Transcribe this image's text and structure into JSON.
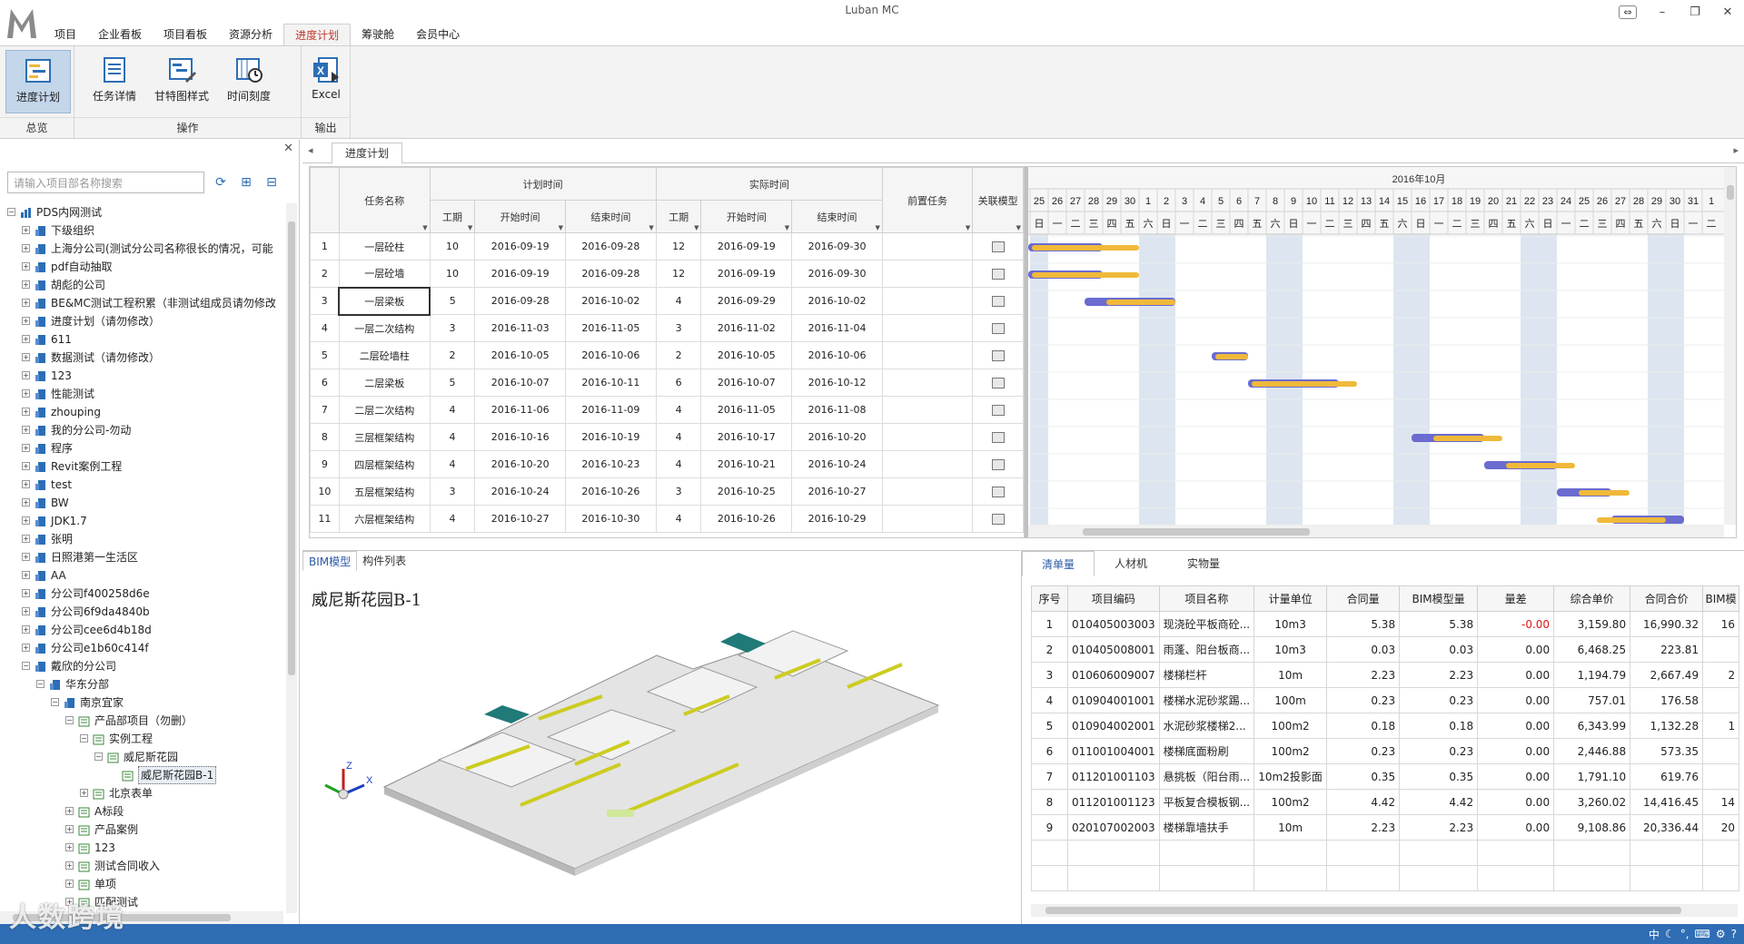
{
  "window": {
    "title": "Luban MC"
  },
  "menu": [
    "项目",
    "企业看板",
    "项目看板",
    "资源分析",
    "进度计划",
    "筹驶舱",
    "会员中心"
  ],
  "menu_active": 4,
  "ribbon": {
    "buttons": [
      {
        "label": "进度计划",
        "icon": "schedule-icon",
        "selected": true
      },
      {
        "label": "任务详情",
        "icon": "task-details-icon"
      },
      {
        "label": "甘特图样式",
        "icon": "gantt-style-icon"
      },
      {
        "label": "时间刻度",
        "icon": "time-scale-icon"
      },
      {
        "label": "Excel",
        "icon": "excel-icon"
      }
    ],
    "groups": [
      "总览",
      "操作",
      "输出"
    ]
  },
  "left_panel": {
    "search_placeholder": "请输入项目部名称搜索",
    "tree": [
      {
        "label": "PDS内网测试",
        "level": 0,
        "expanded": true
      },
      {
        "label": "下级组织",
        "level": 1
      },
      {
        "label": "上海分公司(测试分公司名称很长的情况，可能",
        "level": 1
      },
      {
        "label": "pdf自动抽取",
        "level": 1
      },
      {
        "label": "胡彪的公司",
        "level": 1
      },
      {
        "label": "BE&MC测试工程积累（非测试组成员请勿修改",
        "level": 1
      },
      {
        "label": "进度计划（请勿修改）",
        "level": 1
      },
      {
        "label": "611",
        "level": 1
      },
      {
        "label": "数据测试（请勿修改）",
        "level": 1
      },
      {
        "label": "123",
        "level": 1
      },
      {
        "label": "性能测试",
        "level": 1
      },
      {
        "label": "zhouping",
        "level": 1
      },
      {
        "label": "我的分公司-勿动",
        "level": 1
      },
      {
        "label": "程序",
        "level": 1
      },
      {
        "label": "Revit案例工程",
        "level": 1
      },
      {
        "label": "test",
        "level": 1
      },
      {
        "label": "BW",
        "level": 1
      },
      {
        "label": "JDK1.7",
        "level": 1
      },
      {
        "label": "张明",
        "level": 1
      },
      {
        "label": "日照港第一生活区",
        "level": 1
      },
      {
        "label": "AA",
        "level": 1
      },
      {
        "label": "分公司f400258d6e",
        "level": 1
      },
      {
        "label": "分公司6f9da4840b",
        "level": 1
      },
      {
        "label": "分公司cee6d4b18d",
        "level": 1
      },
      {
        "label": "分公司e1b60c414f",
        "level": 1
      },
      {
        "label": "戴欣的分公司",
        "level": 1,
        "expanded": true
      },
      {
        "label": "华东分部",
        "level": 2,
        "expanded": true
      },
      {
        "label": "南京宜家",
        "level": 3,
        "expanded": true
      },
      {
        "label": "产品部项目（勿删）",
        "level": 4,
        "expanded": true
      },
      {
        "label": "实例工程",
        "level": 5,
        "expanded": true
      },
      {
        "label": "威尼斯花园",
        "level": 6,
        "expanded": true
      },
      {
        "label": "威尼斯花园B-1",
        "level": 7,
        "selected": true
      },
      {
        "label": "北京表单",
        "level": 5
      },
      {
        "label": "A标段",
        "level": 4
      },
      {
        "label": "产品案例",
        "level": 4
      },
      {
        "label": "123",
        "level": 4
      },
      {
        "label": "测试合同收入",
        "level": 4
      },
      {
        "label": "单项",
        "level": 4
      },
      {
        "label": "匹配测试",
        "level": 4
      }
    ]
  },
  "main_tab": "进度计划",
  "task_grid": {
    "headers": {
      "task_name": "任务名称",
      "plan_time": "计划时间",
      "actual_time": "实际时间",
      "duration": "工期",
      "start": "开始时间",
      "end": "结束时间",
      "predecessor": "前置任务",
      "linked_model": "关联模型"
    },
    "rows": [
      {
        "no": "1",
        "name": "一层砼柱",
        "pd": "10",
        "ps": "2016-09-19",
        "pe": "2016-09-28",
        "ad": "12",
        "as": "2016-09-19",
        "ae": "2016-09-30"
      },
      {
        "no": "2",
        "name": "一层砼墙",
        "pd": "10",
        "ps": "2016-09-19",
        "pe": "2016-09-28",
        "ad": "12",
        "as": "2016-09-19",
        "ae": "2016-09-30"
      },
      {
        "no": "3",
        "name": "一层梁板",
        "pd": "5",
        "ps": "2016-09-28",
        "pe": "2016-10-02",
        "ad": "4",
        "as": "2016-09-29",
        "ae": "2016-10-02"
      },
      {
        "no": "4",
        "name": "一层二次结构",
        "pd": "3",
        "ps": "2016-11-03",
        "pe": "2016-11-05",
        "ad": "3",
        "as": "2016-11-02",
        "ae": "2016-11-04"
      },
      {
        "no": "5",
        "name": "二层砼墙柱",
        "pd": "2",
        "ps": "2016-10-05",
        "pe": "2016-10-06",
        "ad": "2",
        "as": "2016-10-05",
        "ae": "2016-10-06"
      },
      {
        "no": "6",
        "name": "二层梁板",
        "pd": "5",
        "ps": "2016-10-07",
        "pe": "2016-10-11",
        "ad": "6",
        "as": "2016-10-07",
        "ae": "2016-10-12"
      },
      {
        "no": "7",
        "name": "二层二次结构",
        "pd": "4",
        "ps": "2016-11-06",
        "pe": "2016-11-09",
        "ad": "4",
        "as": "2016-11-05",
        "ae": "2016-11-08"
      },
      {
        "no": "8",
        "name": "三层框架结构",
        "pd": "4",
        "ps": "2016-10-16",
        "pe": "2016-10-19",
        "ad": "4",
        "as": "2016-10-17",
        "ae": "2016-10-20"
      },
      {
        "no": "9",
        "name": "四层框架结构",
        "pd": "4",
        "ps": "2016-10-20",
        "pe": "2016-10-23",
        "ad": "4",
        "as": "2016-10-21",
        "ae": "2016-10-24"
      },
      {
        "no": "10",
        "name": "五层框架结构",
        "pd": "3",
        "ps": "2016-10-24",
        "pe": "2016-10-26",
        "ad": "3",
        "as": "2016-10-25",
        "ae": "2016-10-27"
      },
      {
        "no": "11",
        "name": "六层框架结构",
        "pd": "4",
        "ps": "2016-10-27",
        "pe": "2016-10-30",
        "ad": "4",
        "as": "2016-10-26",
        "ae": "2016-10-29"
      }
    ]
  },
  "gantt": {
    "month_label": "2016年10月",
    "days": [
      "25",
      "26",
      "27",
      "28",
      "29",
      "30",
      "1",
      "2",
      "3",
      "4",
      "5",
      "6",
      "7",
      "8",
      "9",
      "10",
      "11",
      "12",
      "13",
      "14",
      "15",
      "16",
      "17",
      "18",
      "19",
      "20",
      "21",
      "22",
      "23",
      "24",
      "25",
      "26",
      "27",
      "28",
      "29",
      "30",
      "31",
      "1"
    ],
    "weekdays": [
      "日",
      "一",
      "二",
      "三",
      "四",
      "五",
      "六",
      "日",
      "一",
      "二",
      "三",
      "四",
      "五",
      "六",
      "日",
      "一",
      "二",
      "三",
      "四",
      "五",
      "六",
      "日",
      "一",
      "二",
      "三",
      "四",
      "五",
      "六",
      "日",
      "一",
      "二",
      "三",
      "四",
      "五",
      "六",
      "日",
      "一",
      "二"
    ],
    "colors": {
      "plan": "#6b6bd0",
      "actual": "#f0b93a",
      "weekend": "#dde6f0"
    }
  },
  "bottom_left": {
    "tabs": [
      "BIM模型",
      "构件列表"
    ],
    "model_title": "威尼斯花园B-1",
    "axis_labels": [
      "Z",
      "X"
    ]
  },
  "bottom_right": {
    "tabs": [
      "清单量",
      "人材机",
      "实物量"
    ],
    "headers": [
      "序号",
      "项目编码",
      "项目名称",
      "计量单位",
      "合同量",
      "BIM模型量",
      "量差",
      "综合单价",
      "合同合价",
      "BIM模"
    ],
    "rows": [
      [
        "1",
        "010405003003",
        "现浇砼平板商砼...",
        "10m3",
        "5.38",
        "5.38",
        "-0.00",
        "3,159.80",
        "16,990.32",
        "16"
      ],
      [
        "2",
        "010405008001",
        "雨蓬、阳台板商...",
        "10m3",
        "0.03",
        "0.03",
        "0.00",
        "6,468.25",
        "223.81",
        ""
      ],
      [
        "3",
        "010606009007",
        "楼梯栏杆",
        "10m",
        "2.23",
        "2.23",
        "0.00",
        "1,194.79",
        "2,667.49",
        "2"
      ],
      [
        "4",
        "010904001001",
        "楼梯水泥砂浆踢...",
        "100m",
        "0.23",
        "0.23",
        "0.00",
        "757.01",
        "176.58",
        ""
      ],
      [
        "5",
        "010904002001",
        "水泥砂浆楼梯2...",
        "100m2",
        "0.18",
        "0.18",
        "0.00",
        "6,343.99",
        "1,132.28",
        "1"
      ],
      [
        "6",
        "011001004001",
        "楼梯底面粉刷",
        "100m2",
        "0.23",
        "0.23",
        "0.00",
        "2,446.88",
        "573.35",
        ""
      ],
      [
        "7",
        "011201001103",
        "悬挑板（阳台雨...",
        "10m2投影面",
        "0.35",
        "0.35",
        "0.00",
        "1,791.10",
        "619.76",
        ""
      ],
      [
        "8",
        "011201001123",
        "平板复合模板钢...",
        "100m2",
        "4.42",
        "4.42",
        "0.00",
        "3,260.02",
        "14,416.45",
        "14"
      ],
      [
        "9",
        "020107002003",
        "楼梯靠墙扶手",
        "10m",
        "2.23",
        "2.23",
        "0.00",
        "9,108.86",
        "20,336.44",
        "20"
      ]
    ]
  },
  "taskbar": {
    "tray_text": "中"
  },
  "watermark": "人数跨境"
}
